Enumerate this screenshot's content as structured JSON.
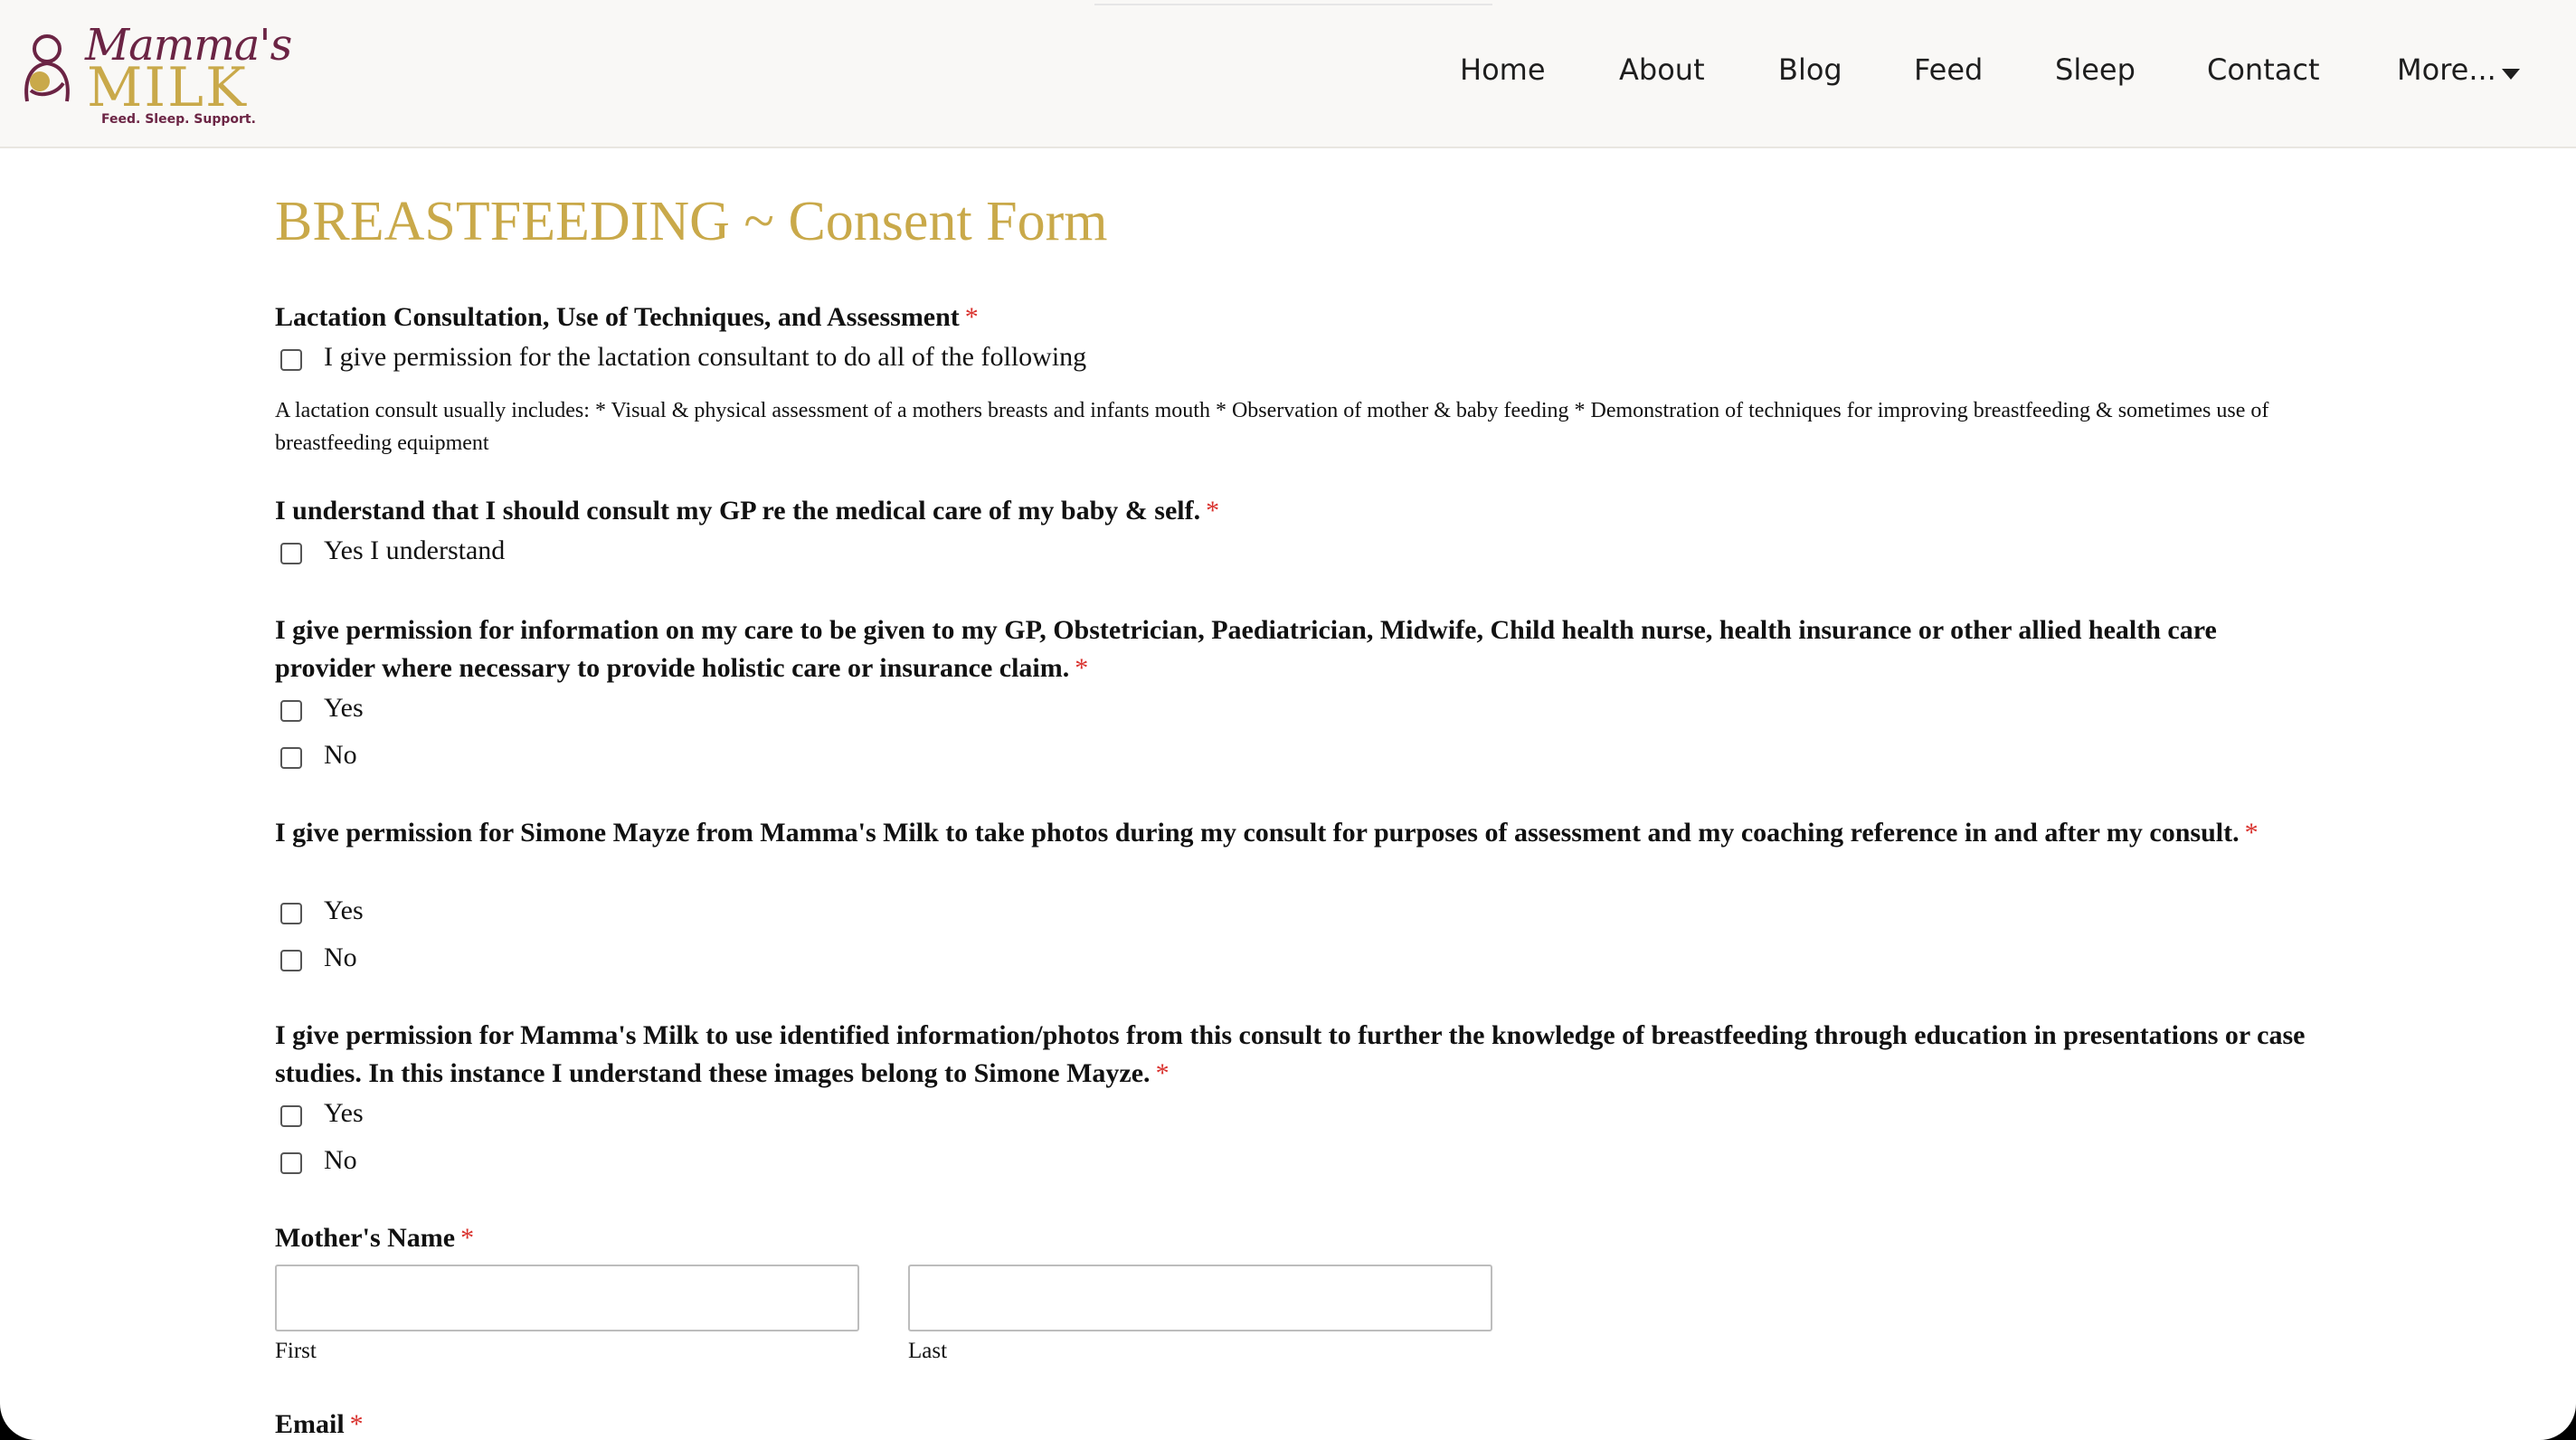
{
  "header": {
    "logo": {
      "line1": "Mamma's",
      "line2": "MILK",
      "tagline": "Feed. Sleep. Support."
    },
    "nav": [
      "Home",
      "About",
      "Blog",
      "Feed",
      "Sleep",
      "Contact",
      "More..."
    ]
  },
  "form": {
    "title": "BREASTFEEDING ~ Consent Form",
    "required_marker": "*",
    "q1": {
      "label": "Lactation Consultation, Use of Techniques, and Assessment",
      "option": "I give permission for the lactation consultant to do all of the following",
      "description": "A lactation consult usually includes: * Visual & physical assessment of a mothers breasts and infants mouth * Observation of mother & baby feeding * Demonstration of techniques for improving breastfeeding & sometimes use of breastfeeding equipment"
    },
    "q2": {
      "label": "I understand that I should consult my GP re the medical care of my baby & self.",
      "option": "Yes I understand"
    },
    "q3": {
      "label": "I give permission for information on my care to be given to my GP, Obstetrician, Paediatrician, Midwife, Child health nurse, health insurance or other allied health care provider where necessary to provide holistic care or insurance claim.",
      "options": [
        "Yes",
        "No"
      ]
    },
    "q4": {
      "label": "I give permission for Simone Mayze from Mamma's Milk to take photos during my consult for purposes of assessment and my coaching reference in and after my consult.",
      "options": [
        "Yes",
        "No"
      ]
    },
    "q5": {
      "label": "I give permission for Mamma's Milk to use identified information/photos from this consult to further the knowledge of breastfeeding through education in presentations or case studies. In this instance I understand these images belong to Simone Mayze.",
      "options": [
        "Yes",
        "No"
      ]
    },
    "mothers_name": {
      "label": "Mother's Name",
      "first_label": "First",
      "last_label": "Last",
      "first_value": "",
      "last_value": ""
    },
    "email": {
      "label": "Email"
    }
  },
  "colors": {
    "gold": "#c9a94a",
    "plum": "#6b2444",
    "required": "#d9302c"
  }
}
